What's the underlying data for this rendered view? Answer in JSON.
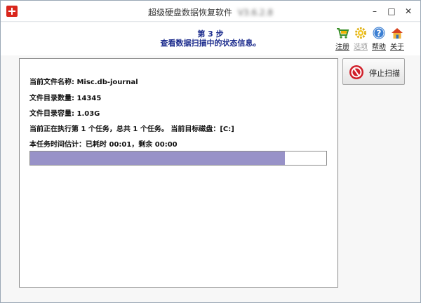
{
  "window": {
    "title": "超级硬盘数据恢复软件",
    "version": "V3.6.2.8"
  },
  "header": {
    "step": "第 3 步",
    "subtitle": "查看数据扫描中的状态信息。"
  },
  "toolbar": {
    "register_label": "注册",
    "options_label": "选项",
    "help_label": "帮助",
    "about_label": "关于"
  },
  "info": {
    "current_file_label": "当前文件名称:",
    "current_file_value": "Misc.db-journal",
    "dir_count_label": "文件目录数量:",
    "dir_count_value": "14345",
    "dir_size_label": "文件目录容量:",
    "dir_size_value": "1.03G",
    "task_line": "当前正在执行第 1 个任务，总共 1 个任务。 当前目标磁盘：[C:]",
    "time_line": "本任务时间估计：已耗时 00:01，剩余 00:00"
  },
  "progress": {
    "fraction": 0.86
  },
  "actions": {
    "stop_label": "停止扫描"
  },
  "colors": {
    "heading": "#1a2a8c",
    "progress_fill": "#9892c8",
    "stop_icon": "#d0202a"
  }
}
